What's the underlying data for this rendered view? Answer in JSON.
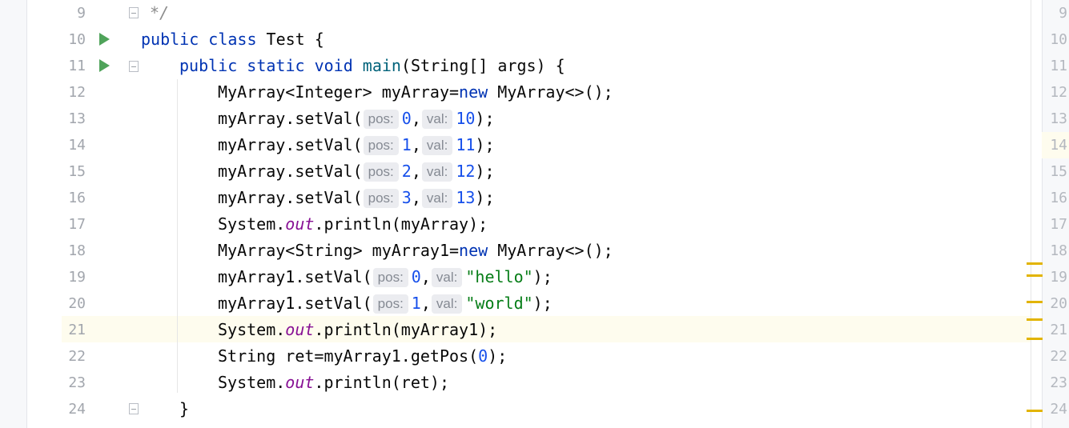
{
  "editor": {
    "lines": [
      {
        "num": "9",
        "text": "*/"
      },
      {
        "num": "10",
        "text": "public class Test {"
      },
      {
        "num": "11",
        "text": "public static void main(String[] args) {"
      },
      {
        "num": "12",
        "text": "MyArray<Integer> myArray=new MyArray<>();"
      },
      {
        "num": "13",
        "text": "myArray.setVal( pos: 0, val: 10);"
      },
      {
        "num": "14",
        "text": "myArray.setVal( pos: 1, val: 11);"
      },
      {
        "num": "15",
        "text": "myArray.setVal( pos: 2, val: 12);"
      },
      {
        "num": "16",
        "text": "myArray.setVal( pos: 3, val: 13);"
      },
      {
        "num": "17",
        "text": "System.out.println(myArray);"
      },
      {
        "num": "18",
        "text": "MyArray<String> myArray1=new MyArray<>();"
      },
      {
        "num": "19",
        "text": "myArray1.setVal( pos: 0, val: \"hello\");"
      },
      {
        "num": "20",
        "text": "myArray1.setVal( pos: 1, val: \"world\");"
      },
      {
        "num": "21",
        "text": "System.out.println(myArray1);"
      },
      {
        "num": "22",
        "text": "String ret=myArray1.getPos(0);"
      },
      {
        "num": "23",
        "text": "System.out.println(ret);"
      },
      {
        "num": "24",
        "text": "}"
      }
    ],
    "current_line": "21",
    "warning_lines": [
      "19",
      "20",
      "21",
      "24"
    ],
    "hints": {
      "pos": "pos:",
      "val": "val:"
    },
    "colors": {
      "keyword": "#0033b3",
      "method_decl": "#00627a",
      "number": "#1750eb",
      "string": "#067d17",
      "static_field": "#871094",
      "run_icon": "#4fa35a",
      "warning_mark": "#e2b400",
      "current_line_bg": "#fefcee"
    }
  }
}
